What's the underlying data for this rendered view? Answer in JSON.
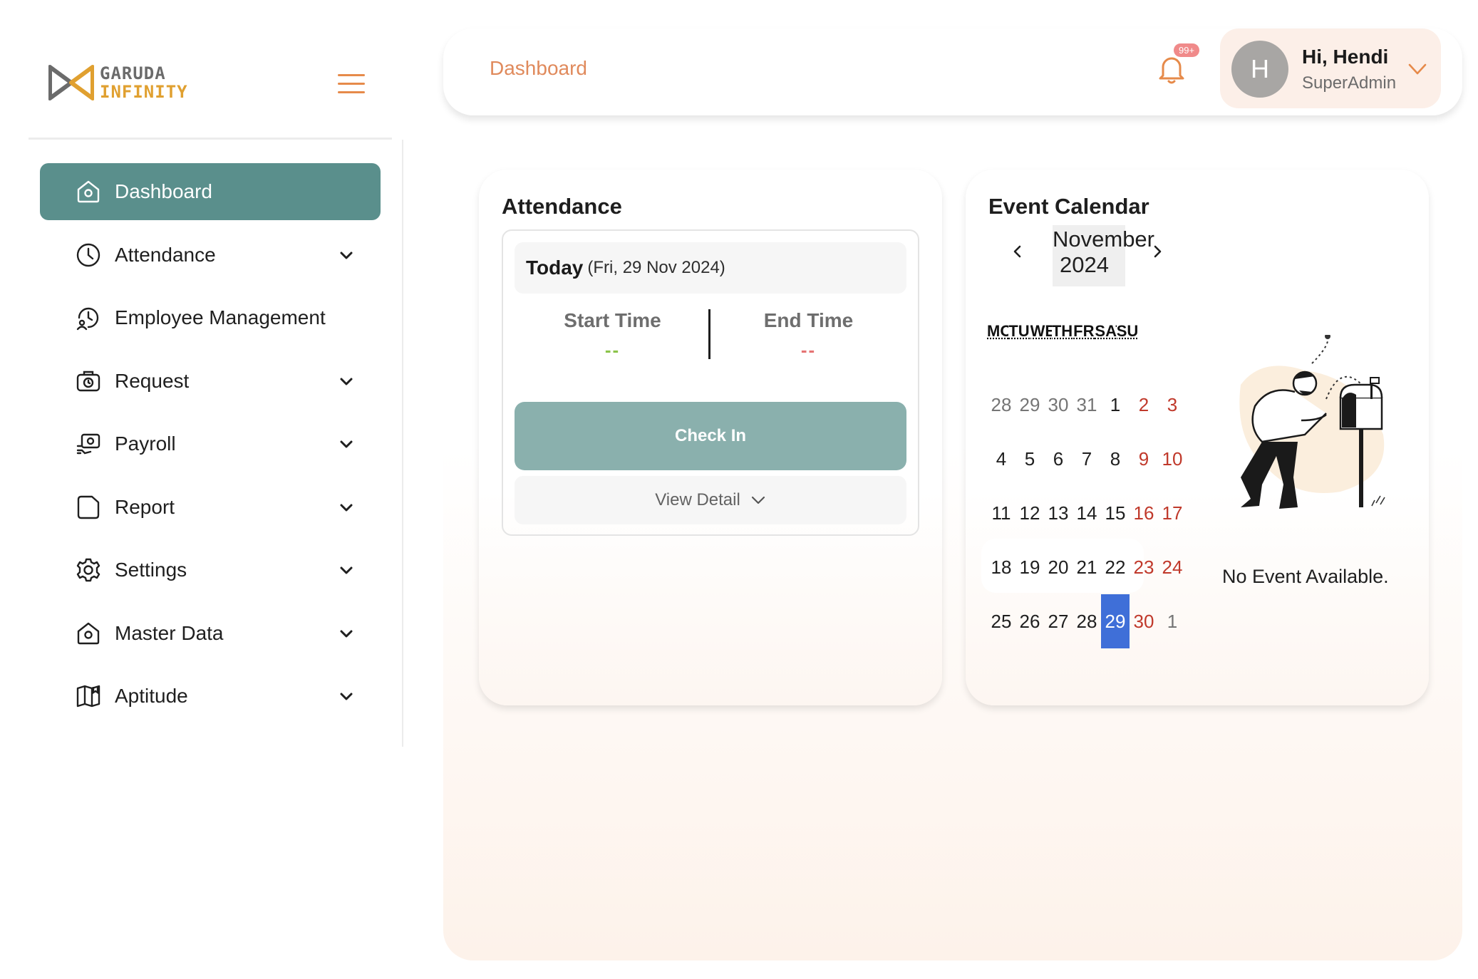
{
  "brand": {
    "line1": "GARUDA",
    "line2": "INFINITY"
  },
  "sidebar": {
    "items": [
      {
        "label": "Dashboard",
        "icon": "home-icon",
        "active": true,
        "has_chevron": false
      },
      {
        "label": "Attendance",
        "icon": "clock-icon",
        "active": false,
        "has_chevron": true
      },
      {
        "label": "Employee Management",
        "icon": "user-clock-icon",
        "active": false,
        "has_chevron": false
      },
      {
        "label": "Request",
        "icon": "briefcase-icon",
        "active": false,
        "has_chevron": true
      },
      {
        "label": "Payroll",
        "icon": "money-icon",
        "active": false,
        "has_chevron": true
      },
      {
        "label": "Report",
        "icon": "folder-icon",
        "active": false,
        "has_chevron": true
      },
      {
        "label": "Settings",
        "icon": "gear-icon",
        "active": false,
        "has_chevron": true
      },
      {
        "label": "Master Data",
        "icon": "home-icon",
        "active": false,
        "has_chevron": true
      },
      {
        "label": "Aptitude",
        "icon": "book-icon",
        "active": false,
        "has_chevron": true
      }
    ]
  },
  "header": {
    "breadcrumb": "Dashboard",
    "notification_badge": "99+",
    "user": {
      "avatar_initial": "H",
      "greeting": "Hi, Hendi",
      "role": "SuperAdmin"
    }
  },
  "attendance": {
    "title": "Attendance",
    "today_label": "Today",
    "today_date": "(Fri, 29 Nov 2024)",
    "start_label": "Start Time",
    "start_value": "--",
    "end_label": "End Time",
    "end_value": "--",
    "check_in_label": "Check In",
    "view_detail_label": "View Detail"
  },
  "calendar": {
    "title": "Event Calendar",
    "month": "November",
    "year": "2024",
    "weekdays": [
      "MON",
      "TUE",
      "WED",
      "THU",
      "FRI",
      "SAT",
      "SUN"
    ],
    "weeks": [
      [
        "28",
        "29",
        "30",
        "31",
        "1",
        "2",
        "3"
      ],
      [
        "4",
        "5",
        "6",
        "7",
        "8",
        "9",
        "10"
      ],
      [
        "11",
        "12",
        "13",
        "14",
        "15",
        "16",
        "17"
      ],
      [
        "18",
        "19",
        "20",
        "21",
        "22",
        "23",
        "24"
      ],
      [
        "25",
        "26",
        "27",
        "28",
        "29",
        "30",
        "1"
      ]
    ],
    "no_event_text": "No Event Available."
  },
  "colors": {
    "sidebar_active": "#5a8f8c",
    "accent_orange": "#e08a5c",
    "check_in_button": "#8ab0ad",
    "today_highlight": "#3f6fd8",
    "weekend_red": "#c0392b",
    "start_time_green": "#8bc34a",
    "end_time_red": "#e57373"
  }
}
